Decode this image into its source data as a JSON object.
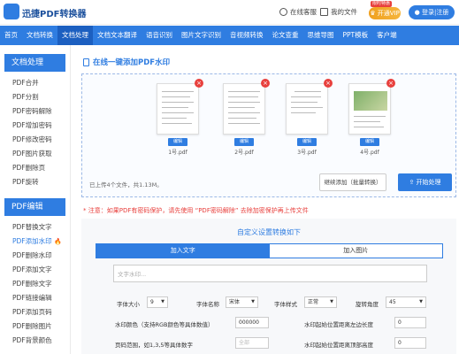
{
  "app": {
    "name": "迅捷PDF转换器"
  },
  "topbar": {
    "online_service": "在线客服",
    "my_files": "我的文件",
    "vip": "开通VIP",
    "vip_tag": "限时特惠",
    "login": "登录|注册"
  },
  "nav": [
    "首页",
    "文档转换",
    "文档处理",
    "文档文本翻译",
    "语音识别",
    "图片文字识别",
    "音视频转换",
    "论文查重",
    "思维导图",
    "PPT模板",
    "客户端"
  ],
  "nav_active": 2,
  "sidebar": {
    "section1_title": "文档处理",
    "section1_items": [
      "PDF合并",
      "PDF分割",
      "PDF密码解除",
      "PDF增加密码",
      "PDF修改密码",
      "PDF图片获取",
      "PDF删除页",
      "PDF旋转"
    ],
    "section2_title": "PDF编辑",
    "section2_items": [
      "PDF替换文字",
      "PDF添加水印",
      "PDF删除水印",
      "PDF添加文字",
      "PDF删除文字",
      "PDF链接编辑",
      "PDF添加页码",
      "PDF删除图片",
      "PDF背景颜色"
    ]
  },
  "main": {
    "title": "在线一键添加PDF水印",
    "files": [
      {
        "name": "1号.pdf",
        "edit": "编辑"
      },
      {
        "name": "2号.pdf",
        "edit": "编辑"
      },
      {
        "name": "3号.pdf",
        "edit": "编辑"
      },
      {
        "name": "4号.pdf",
        "edit": "编辑"
      }
    ],
    "status": "已上传4个文件，共1.13M。",
    "continue_button": "继续添加（批量转换）",
    "start_button": "开始处理",
    "notice": "* 注意：如果PDF有密码保护，请先使用 “PDF密码解除” 去除加密保护再上传文件"
  },
  "settings": {
    "title": "自定义设置转换如下",
    "tab_text": "加入文字",
    "tab_image": "加入图片",
    "watermark_placeholder": "文字水印...",
    "font_size_label": "字体大小",
    "font_size_value": "9",
    "font_name_label": "字体名称",
    "font_name_value": "宋体",
    "font_style_label": "字体样式",
    "font_style_value": "正常",
    "rotation_label": "旋转角度",
    "rotation_value": "45",
    "color_label": "水印颜色（支持RGB颜色等具体数值）",
    "color_value": "000000",
    "left_margin_label": "水印起始位置距离左边长度",
    "left_margin_value": "0",
    "page_range_label": "页码范围，如1,3,5等具体数字",
    "page_range_placeholder": "全部",
    "top_margin_label": "水印起始位置距离顶部高度",
    "top_margin_value": "0"
  },
  "colors": {
    "accent": "#2f7de1",
    "nav_active": "#1c5fc0",
    "danger": "#e8403d",
    "vip": "#f0a01e"
  },
  "icons": [
    "logo-icon",
    "headset-icon",
    "file-icon",
    "crown-icon",
    "user-icon",
    "fire-icon",
    "close-icon",
    "upload-icon"
  ]
}
